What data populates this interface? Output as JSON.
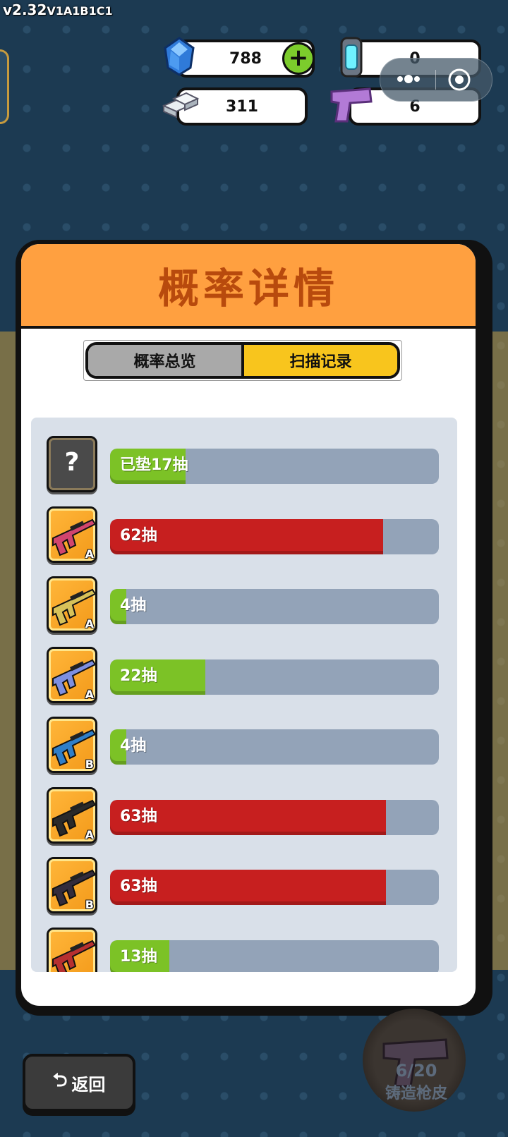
{
  "version": {
    "main": "v2.32",
    "suffix": "V1A1B1C1"
  },
  "resources": {
    "gems": "788",
    "silver": "311",
    "cores": "0",
    "pistols": "6"
  },
  "icons": {
    "gem": "gem-icon",
    "silver": "silver-bars-icon",
    "core": "energy-core-icon",
    "pistol": "pistol-icon"
  },
  "modal": {
    "title": "概率详情",
    "tabs": {
      "overview": "概率总览",
      "record": "扫描记录",
      "active": "record"
    }
  },
  "records": [
    {
      "grade": "",
      "label": "已垫17抽",
      "fill": 0.23,
      "status": "green",
      "unknown": true
    },
    {
      "grade": "A",
      "label": "62抽",
      "fill": 0.83,
      "status": "red",
      "gun_color": "#d2456e"
    },
    {
      "grade": "A",
      "label": "4抽",
      "fill": 0.05,
      "status": "green",
      "gun_color": "#d7c259"
    },
    {
      "grade": "A",
      "label": "22抽",
      "fill": 0.29,
      "status": "green",
      "gun_color": "#7d8fe0"
    },
    {
      "grade": "B",
      "label": "4抽",
      "fill": 0.05,
      "status": "green",
      "gun_color": "#2f7ec8"
    },
    {
      "grade": "A",
      "label": "63抽",
      "fill": 0.84,
      "status": "red",
      "gun_color": "#2a2a2a"
    },
    {
      "grade": "B",
      "label": "63抽",
      "fill": 0.84,
      "status": "red",
      "gun_color": "#332c3c"
    },
    {
      "grade": "",
      "label": "13抽",
      "fill": 0.18,
      "status": "green",
      "gun_color": "#b73030"
    }
  ],
  "back_button": {
    "label": "返回"
  },
  "forge": {
    "count": "6/20",
    "label": "铸造枪皮"
  },
  "colors": {
    "green": "#7cc226",
    "red": "#c71f1f",
    "header": "#ffa040",
    "title": "#b84a0d",
    "active_tab": "#f8c51d"
  }
}
